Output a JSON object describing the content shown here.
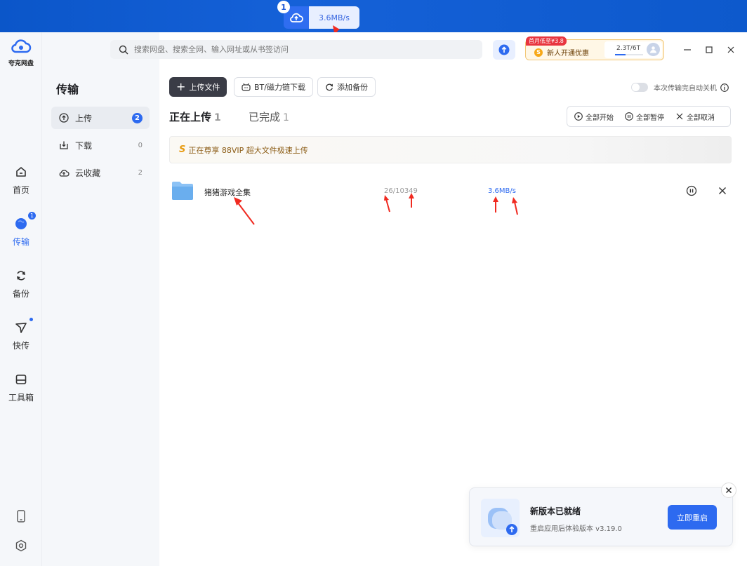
{
  "float_widget": {
    "badge": "1",
    "speed": "3.6MB/s"
  },
  "app": {
    "logo_label": "夸克网盘"
  },
  "rail": {
    "items": [
      {
        "label": "首页",
        "icon": "home-icon"
      },
      {
        "label": "传输",
        "icon": "transfer-globe-icon",
        "badge": "1"
      },
      {
        "label": "备份",
        "icon": "backup-sync-icon"
      },
      {
        "label": "快传",
        "icon": "quick-send-icon"
      },
      {
        "label": "工具箱",
        "icon": "toolbox-icon"
      }
    ]
  },
  "sub_nav": {
    "title": "传输",
    "items": [
      {
        "label": "上传",
        "count": "2",
        "icon": "upload-circle-icon"
      },
      {
        "label": "下载",
        "count": "0",
        "icon": "download-box-icon"
      },
      {
        "label": "云收藏",
        "count": "2",
        "icon": "cloud-save-icon"
      }
    ]
  },
  "header": {
    "search_placeholder": "搜索网盘、搜索全网、输入网址或从书签访问",
    "promo_tag": "首月低至¥3.8",
    "promo_text": "新人开通优惠",
    "promo_coin": "S",
    "quota_text": "2.3T/6T",
    "quota_fraction": 0.38
  },
  "toolbar": {
    "upload_label": "上传文件",
    "bt_label": "BT/磁力链下载",
    "backup_label": "添加备份",
    "shutdown_label": "本次传输完自动关机"
  },
  "tabs": [
    {
      "label": "正在上传",
      "count": "1"
    },
    {
      "label": "已完成",
      "count": "1"
    }
  ],
  "bulk": {
    "start_all": "全部开始",
    "pause_all": "全部暂停",
    "cancel_all": "全部取消"
  },
  "vip_banner": {
    "icon_letter": "S",
    "text": "正在尊享 88VIP 超大文件极速上传"
  },
  "file_row": {
    "name": "猪猪游戏全集",
    "progress": "26/10349",
    "speed": "3.6MB/s"
  },
  "toast": {
    "title": "新版本已就绪",
    "subtitle": "重启应用后体验版本 v3.19.0",
    "button": "立即重启"
  },
  "colors": {
    "accent": "#2d6af0",
    "desktop_bar": "#1561d8",
    "arrow": "#f02a20"
  }
}
